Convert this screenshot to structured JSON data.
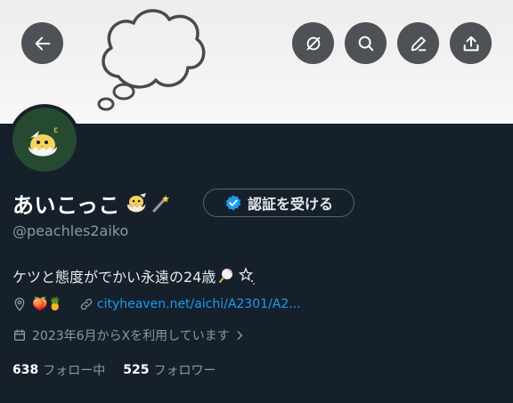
{
  "header": {
    "buttons": [
      {
        "name": "back-button",
        "icon": "arrow-left-icon"
      },
      {
        "name": "grok-button",
        "icon": "slash-circle-icon"
      },
      {
        "name": "search-button",
        "icon": "search-icon"
      },
      {
        "name": "edit-button",
        "icon": "pencil-icon"
      },
      {
        "name": "share-button",
        "icon": "share-icon"
      }
    ]
  },
  "profile": {
    "display_name": "あいこっこ",
    "handle": "@peachles2aiko",
    "verify_label": "認証を受ける",
    "bio": "ケツと態度がでかい永遠の24歳",
    "location_emoji": "🍑🍍",
    "website": "cityheaven.net/aichi/A2301/A2...",
    "joined": "2023年6月からXを利用しています",
    "following_count": "638",
    "following_label": "フォロー中",
    "followers_count": "525",
    "followers_label": "フォロワー"
  },
  "colors": {
    "background": "#15202b",
    "link": "#1d9bf0",
    "verified": "#1d9bf0",
    "muted": "#8b98a5"
  }
}
